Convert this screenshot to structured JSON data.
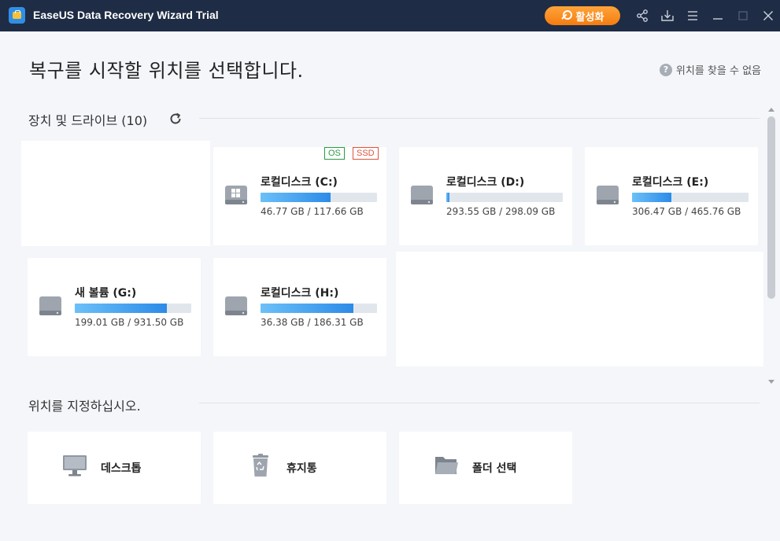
{
  "titlebar": {
    "app_title": "EaseUS Data Recovery Wizard  Trial",
    "activate_label": "활성화",
    "icons": [
      "share-icon",
      "download-icon",
      "menu-icon",
      "minimize-icon",
      "maximize-icon",
      "close-icon"
    ],
    "accent_color": "#f57c10",
    "bar_color": "#1f2c45"
  },
  "header": {
    "title": "복구를 시작할 위치를 선택합니다.",
    "help_label": "위치를 찾을 수 없음",
    "help_icon": "?"
  },
  "devices": {
    "section_title": "장치 및 드라이브 (10)",
    "drives": [
      {
        "name": "로컬디스크   (C:)",
        "size": "46.77 GB / 117.66 GB",
        "usage": 0.6,
        "tags": [
          "OS",
          "SSD"
        ],
        "icon": "windows-drive-icon"
      },
      {
        "name": "로컬디스크 (D:)",
        "size": "293.55 GB / 298.09 GB",
        "usage": 0.03,
        "tags": [],
        "icon": "hard-drive-icon"
      },
      {
        "name": "로컬디스크 (E:)",
        "size": "306.47 GB / 465.76 GB",
        "usage": 0.34,
        "tags": [],
        "icon": "hard-drive-icon"
      },
      {
        "name": "새 볼륨 (G:)",
        "size": "199.01 GB / 931.50 GB",
        "usage": 0.79,
        "tags": [],
        "icon": "hard-drive-icon"
      },
      {
        "name": "로컬디스크 (H:)",
        "size": "36.38 GB / 186.31 GB",
        "usage": 0.8,
        "tags": [],
        "icon": "hard-drive-icon"
      }
    ]
  },
  "locations": {
    "section_title": "위치를 지정하십시오.",
    "items": [
      {
        "label": "데스크톱",
        "icon": "desktop-icon"
      },
      {
        "label": "휴지통",
        "icon": "recycle-bin-icon"
      },
      {
        "label": "폴더 선택",
        "icon": "folder-icon"
      }
    ]
  }
}
